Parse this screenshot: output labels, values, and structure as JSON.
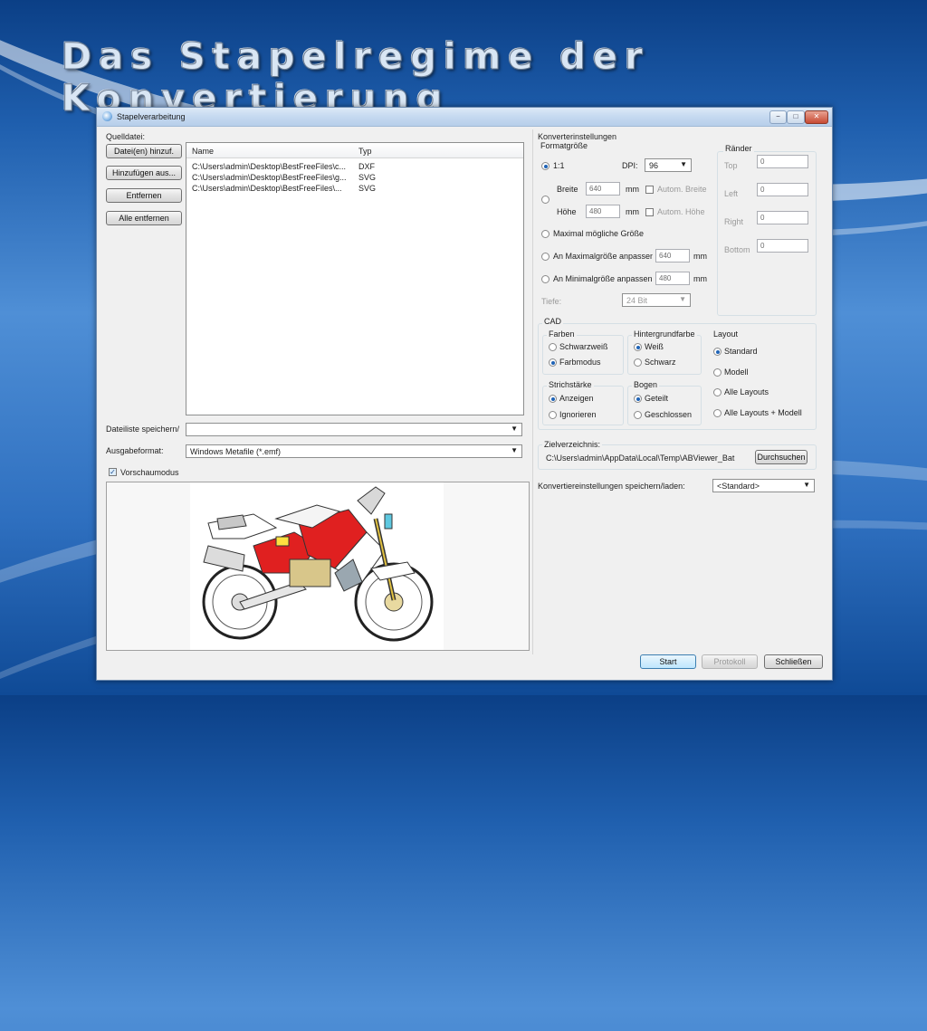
{
  "slide": {
    "title": "Das Stapelregime der Konvertierung"
  },
  "window": {
    "title": "Stapelverarbeitung",
    "controls": {
      "minimize": "−",
      "maximize": "□",
      "close": "✕"
    }
  },
  "source": {
    "label": "Quelldatei:",
    "buttons": {
      "add_files": "Datei(en) hinzuf.",
      "add_from": "Hinzufügen aus...",
      "remove": "Entfernen",
      "remove_all": "Alle entfernen"
    },
    "columns": [
      "Name",
      "Typ"
    ],
    "rows": [
      {
        "name": "C:\\Users\\admin\\Desktop\\BestFreeFiles\\c...",
        "type": "DXF"
      },
      {
        "name": "C:\\Users\\admin\\Desktop\\BestFreeFiles\\g...",
        "type": "SVG"
      },
      {
        "name": "C:\\Users\\admin\\Desktop\\BestFreeFiles\\...",
        "type": "SVG"
      }
    ]
  },
  "filelist_save": {
    "label": "Dateiliste speichern/",
    "value": ""
  },
  "output_format": {
    "label": "Ausgabeformat:",
    "value": "Windows Metafile (*.emf)"
  },
  "preview": {
    "label": "Vorschaumodus",
    "checked": true
  },
  "converter": {
    "label": "Konverterinstellungen",
    "format_size": {
      "label": "Formatgröße",
      "ratio_label": "1:1",
      "dpi_label": "DPI:",
      "dpi_value": "96",
      "width_label": "Breite",
      "width_value": "640",
      "width_unit": "mm",
      "auto_width": "Autom. Breite",
      "height_label": "Höhe",
      "height_value": "480",
      "height_unit": "mm",
      "auto_height": "Autom. Höhe",
      "max_possible": "Maximal mögliche Größe",
      "fit_max": "An Maximalgröße anpassen",
      "fit_max_value": "640",
      "fit_max_unit": "mm",
      "fit_min": "An Minimalgröße anpassen",
      "fit_min_value": "480",
      "fit_min_unit": "mm",
      "depth_label": "Tiefe:",
      "depth_value": "24 Bit"
    },
    "margins": {
      "label": "Ränder",
      "top_label": "Top",
      "top_value": "0",
      "left_label": "Left",
      "left_value": "0",
      "right_label": "Right",
      "right_value": "0",
      "bottom_label": "Bottom",
      "bottom_value": "0"
    },
    "cad": {
      "label": "CAD",
      "colors": {
        "label": "Farben",
        "bw": "Schwarzweiß",
        "color": "Farbmodus"
      },
      "background": {
        "label": "Hintergrundfarbe",
        "white": "Weiß",
        "black": "Schwarz"
      },
      "layout": {
        "label": "Layout",
        "standard": "Standard",
        "model": "Modell",
        "all": "Alle Layouts",
        "all_model": "Alle Layouts + Modell"
      },
      "stroke": {
        "label": "Strichstärke",
        "show": "Anzeigen",
        "ignore": "Ignorieren"
      },
      "arc": {
        "label": "Bogen",
        "split": "Geteilt",
        "closed": "Geschlossen"
      }
    },
    "target": {
      "label": "Zielverzeichnis:",
      "path": "C:\\Users\\admin\\AppData\\Local\\Temp\\ABViewer_Bat",
      "browse": "Durchsuchen"
    },
    "save_load": {
      "label": "Konvertiereinstellungen speichern/laden:",
      "value": "<Standard>"
    }
  },
  "footer": {
    "start": "Start",
    "log": "Protokoll",
    "close": "Schließen"
  }
}
